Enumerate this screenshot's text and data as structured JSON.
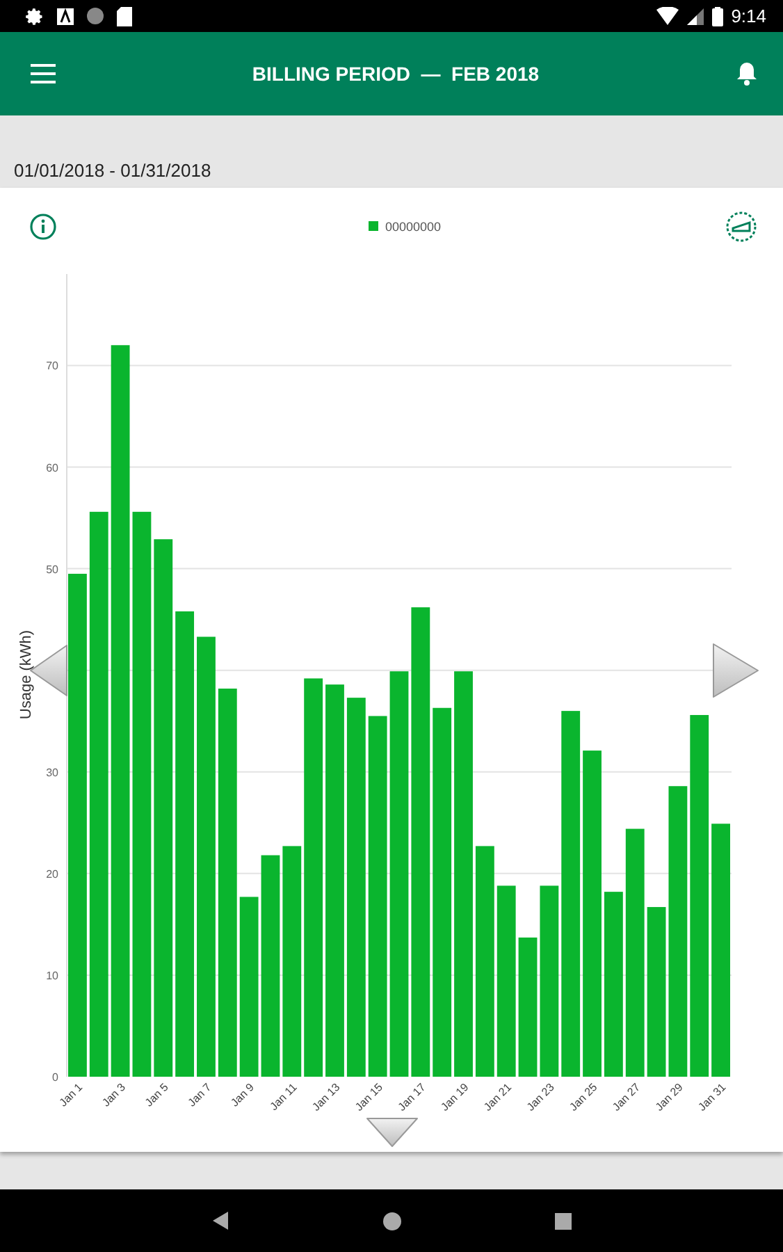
{
  "status_bar": {
    "time": "9:14"
  },
  "app_bar": {
    "title": "BILLING PERIOD  —  FEB 2018"
  },
  "period": {
    "dates": "01/01/2018 - 01/31/2018"
  },
  "chart_card": {
    "chart_data": {
      "type": "bar",
      "ylabel": "Usage (kWh)",
      "categories": [
        "Jan 1",
        null,
        "Jan 3",
        null,
        "Jan 5",
        null,
        "Jan 7",
        null,
        "Jan 9",
        null,
        "Jan 11",
        null,
        "Jan 13",
        null,
        "Jan 15",
        null,
        "Jan 17",
        null,
        "Jan 19",
        null,
        "Jan 21",
        null,
        "Jan 23",
        null,
        "Jan 25",
        null,
        "Jan 27",
        null,
        "Jan 29",
        null,
        "Jan 31"
      ],
      "ylim": [
        0,
        79
      ],
      "grid": true,
      "yticks": [
        0,
        10,
        20,
        30,
        50,
        60,
        70
      ],
      "series": [
        {
          "name": "00000000",
          "color": "#0ab52e",
          "values": [
            49.5,
            55.6,
            72,
            55.6,
            52.9,
            45.8,
            43.3,
            38.2,
            17.7,
            21.8,
            22.7,
            39.2,
            38.6,
            37.3,
            35.5,
            39.9,
            46.2,
            36.3,
            39.9,
            22.7,
            18.8,
            13.7,
            18.8,
            36,
            32.1,
            18.2,
            24.4,
            16.7,
            28.6,
            35.6,
            24.9
          ]
        }
      ]
    }
  }
}
